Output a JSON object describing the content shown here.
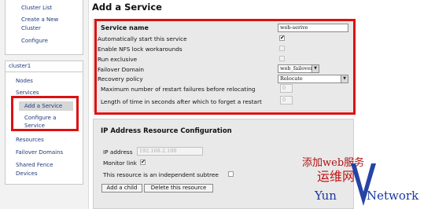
{
  "sidebar": {
    "links_top": [
      "Cluster List",
      "Create a New Cluster",
      "Configure"
    ],
    "cluster_name": "cluster1",
    "items": [
      "Nodes",
      "Services",
      "Add a Service",
      "Configure a Service",
      "Resources",
      "Failover Domains",
      "Shared Fence Devices"
    ]
  },
  "main": {
    "title": "Add a Service",
    "service_name_label": "Service name",
    "service_name_value": "web-serive",
    "autostart_label": "Automatically start this service",
    "autostart_checked": true,
    "nfs_label": "Enable NFS lock workarounds",
    "nfs_checked": false,
    "exclusive_label": "Run exclusive",
    "exclusive_checked": false,
    "failover_label": "Failover Domain",
    "failover_value": "web_failover",
    "recovery_label": "Recovery policy",
    "recovery_value": "Relocate",
    "max_restart_label": "Maximum number of restart failures before relocating",
    "max_restart_value": "0",
    "forget_label": "Length of time in seconds after which to forget a restart",
    "forget_value": "0"
  },
  "resource": {
    "section_title": "IP Address Resource Configuration",
    "ip_label": "IP address",
    "ip_value": "192.168.2.100",
    "monitor_label": "Monitor link",
    "monitor_checked": true,
    "subtree_label": "This resource is an independent subtree",
    "subtree_checked": false,
    "add_child_label": "Add a child",
    "delete_label": "Delete this resource"
  },
  "watermark": {
    "line1": "添加web服务",
    "line2": "运维网",
    "line3_left": "Yun",
    "line3_right": "Network"
  },
  "colors": {
    "highlight_border": "#dd1111",
    "link": "#1f3c7a",
    "watermark_red": "#c01010",
    "watermark_blue": "#1a3aa0"
  }
}
